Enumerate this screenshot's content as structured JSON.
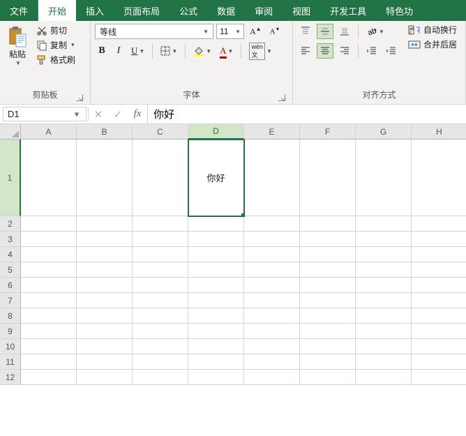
{
  "tabs": {
    "file": "文件",
    "home": "开始",
    "insert": "插入",
    "pageLayout": "页面布局",
    "formulas": "公式",
    "data": "数据",
    "review": "审阅",
    "view": "视图",
    "dev": "开发工具",
    "special": "特色功"
  },
  "clipboard": {
    "paste": "粘贴",
    "cut": "剪切",
    "copy": "复制",
    "formatPainter": "格式刷",
    "groupLabel": "剪贴板"
  },
  "font": {
    "name": "等线",
    "size": "11",
    "groupLabel": "字体"
  },
  "align": {
    "wrap": "自动换行",
    "merge": "合并后居",
    "groupLabel": "对齐方式"
  },
  "namebox": "D1",
  "formula": "你好",
  "columns": [
    "A",
    "B",
    "C",
    "D",
    "E",
    "F",
    "G",
    "H"
  ],
  "rows": [
    "1",
    "2",
    "3",
    "4",
    "5",
    "6",
    "7",
    "8",
    "9",
    "10",
    "11",
    "12"
  ],
  "activeCell": {
    "col": "D",
    "row": "1",
    "value": "你好"
  }
}
